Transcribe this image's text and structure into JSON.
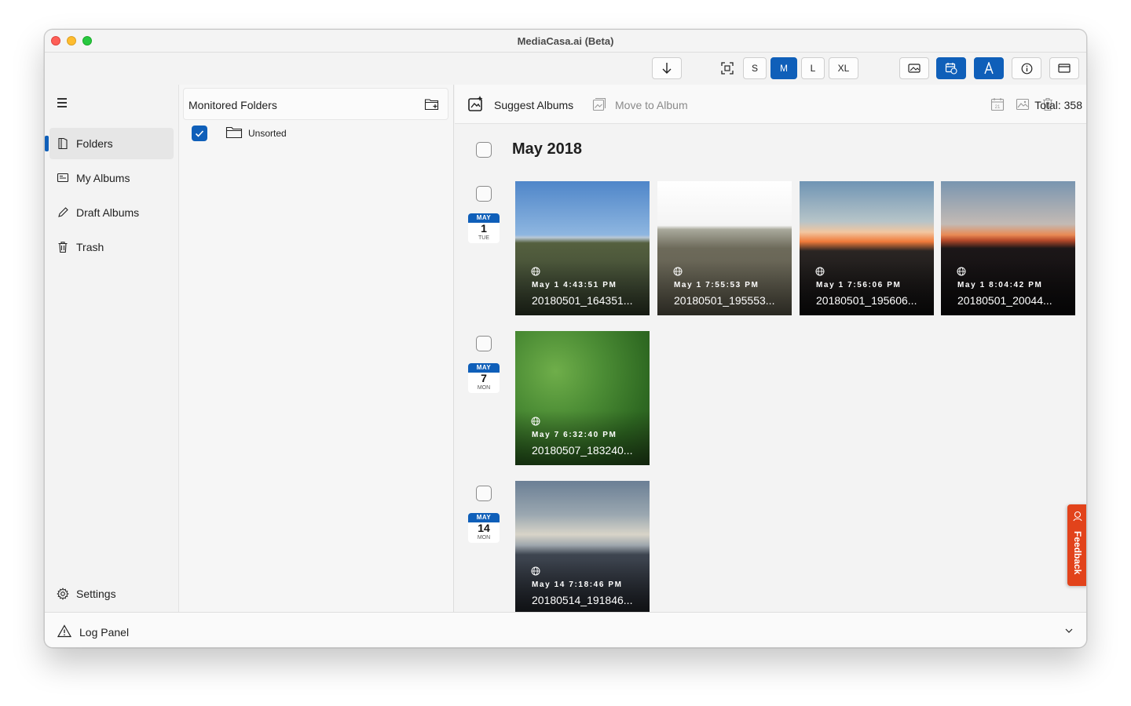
{
  "window": {
    "title": "MediaCasa.ai (Beta)"
  },
  "toolbar": {
    "download_icon": "arrow-down-icon",
    "fit_icon": "fit-screen-icon",
    "sizes": [
      "S",
      "M",
      "L",
      "XL"
    ],
    "active_size": "M",
    "right_icons": [
      "image-view-icon",
      "calendar-sync-icon",
      "text-a-icon",
      "info-icon",
      "panel-icon"
    ],
    "accent_color": "#0f5fb9"
  },
  "sidebar": {
    "items": [
      {
        "label": "Folders",
        "icon": "folders-icon",
        "selected": true
      },
      {
        "label": "My Albums",
        "icon": "albums-icon",
        "selected": false
      },
      {
        "label": "Draft Albums",
        "icon": "pencil-icon",
        "selected": false
      },
      {
        "label": "Trash",
        "icon": "trash-icon",
        "selected": false
      }
    ],
    "settings_label": "Settings"
  },
  "folders_panel": {
    "title": "Monitored Folders",
    "folders": [
      {
        "label": "Unsorted",
        "checked": true
      }
    ]
  },
  "main": {
    "suggest_label": "Suggest Albums",
    "move_label": "Move to Album",
    "total_label": "Total: 358",
    "month_title": "May 2018",
    "days": [
      {
        "month": "MAY",
        "day": "1",
        "dow": "TUE"
      },
      {
        "month": "MAY",
        "day": "7",
        "dow": "MON"
      },
      {
        "month": "MAY",
        "day": "14",
        "dow": "MON"
      }
    ],
    "photos": [
      {
        "time": "May 1 4:43:51 PM",
        "name": "20180501_164351..."
      },
      {
        "time": "May 1 7:55:53 PM",
        "name": "20180501_195553..."
      },
      {
        "time": "May 1 7:56:06 PM",
        "name": "20180501_195606..."
      },
      {
        "time": "May 1 8:04:42 PM",
        "name": "20180501_20044..."
      },
      {
        "time": "May 7 6:32:40 PM",
        "name": "20180507_183240..."
      },
      {
        "time": "May 14 7:18:46 PM",
        "name": "20180514_191846..."
      }
    ]
  },
  "log_panel": {
    "label": "Log Panel"
  },
  "feedback": {
    "label": "Feedback",
    "color": "#e2431b"
  }
}
